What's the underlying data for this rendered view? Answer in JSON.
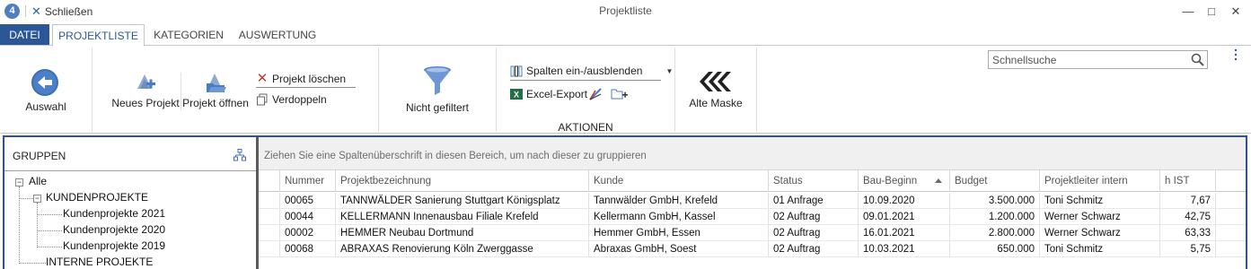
{
  "titlebar": {
    "logo": "4",
    "close_label": "Schließen",
    "window_title": "Projektliste",
    "minimize": "—",
    "maximize": "□",
    "close": "✕"
  },
  "tabs": [
    {
      "label": "DATEI"
    },
    {
      "label": "PROJEKTLISTE"
    },
    {
      "label": "KATEGORIEN"
    },
    {
      "label": "AUSWERTUNG"
    }
  ],
  "ribbon": {
    "auswahl": "Auswahl",
    "neues_projekt": "Neues Projekt",
    "projekt_oeffnen": "Projekt öffnen",
    "projekt_loeschen": "Projekt löschen",
    "verdoppeln": "Verdoppeln",
    "filter": "Nicht gefiltert",
    "spalten": "Spalten ein-/ausblenden",
    "excel_export": "Excel-Export",
    "group_aktionen": "AKTIONEN",
    "alte_maske": "Alte Maske",
    "search_placeholder": "Schnellsuche"
  },
  "groups": {
    "title": "GRUPPEN",
    "tree": {
      "root": "Alle",
      "kunden": "KUNDENPROJEKTE",
      "k2021": "Kundenprojekte 2021",
      "k2020": "Kundenprojekte 2020",
      "k2019": "Kundenprojekte 2019",
      "intern": "INTERNE PROJEKTE"
    }
  },
  "grid": {
    "group_hint": "Ziehen Sie eine Spaltenüberschrift in diesen Bereich, um nach dieser zu gruppieren",
    "columns": [
      "Nummer",
      "Projektbezeichnung",
      "Kunde",
      "Status",
      "Bau-Beginn",
      "Budget",
      "Projektleiter intern",
      "h IST"
    ],
    "sorted_column": "Bau-Beginn",
    "sort_direction": "ascending",
    "rows": [
      [
        "00065",
        "TANNWÄLDER Sanierung Stuttgart Königsplatz",
        "Tannwälder GmbH, Krefeld",
        "01 Anfrage",
        "10.09.2020",
        "3.500.000",
        "Toni Schmitz",
        "7,67"
      ],
      [
        "00044",
        "KELLERMANN Innenausbau Filiale Krefeld",
        "Kellermann GmbH, Kassel",
        "02 Auftrag",
        "09.01.2021",
        "1.200.000",
        "Werner Schwarz",
        "42,75"
      ],
      [
        "00002",
        "HEMMER Neubau Dortmund",
        "Hemmer GmbH, Essen",
        "02 Auftrag",
        "16.01.2021",
        "2.800.000",
        "Werner Schwarz",
        "63,33"
      ],
      [
        "00068",
        "ABRAXAS Renovierung Köln Zwerggasse",
        "Abraxas GmbH, Soest",
        "02 Auftrag",
        "10.03.2021",
        "650.000",
        "Toni Schmitz",
        "5,75"
      ]
    ]
  },
  "colors": {
    "accent": "#2b5797",
    "frame_border": "#2e4fa8",
    "delete_red": "#c0392b",
    "excel_green": "#1e7145"
  }
}
